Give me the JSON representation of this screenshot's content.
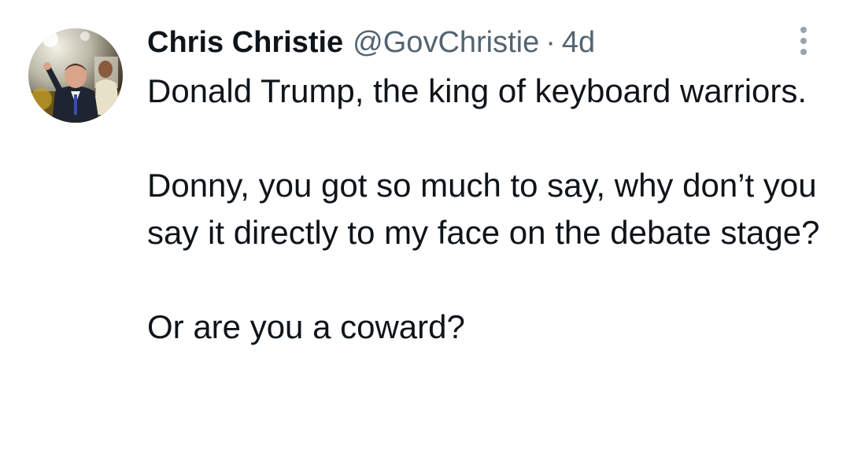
{
  "author": {
    "name": "Chris Christie",
    "handle": "@GovChristie",
    "separator": "·",
    "time": "4d",
    "avatar_icon": "profile-photo"
  },
  "menu_icon": "more-options-icon",
  "tweet": {
    "paragraphs": [
      "Donald Trump, the king of keyboard warriors.",
      "Donny, you got so much to say, why don’t you say it directly to my face on the debate stage?",
      "Or are you a coward?"
    ]
  },
  "colors": {
    "text": "#0f1419",
    "secondary": "#536471",
    "background": "#ffffff"
  }
}
